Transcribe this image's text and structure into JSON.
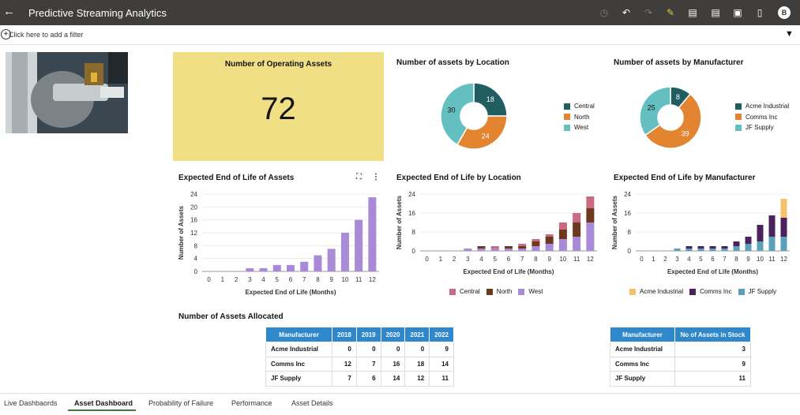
{
  "header": {
    "back_icon": "back-arrow-icon",
    "title": "Predictive Streaming Analytics",
    "avatar": "B"
  },
  "filterbar": {
    "placeholder": "Click here to add a filter"
  },
  "kpi": {
    "title": "Number of Operating Assets",
    "value": "72",
    "bg": "#f0df85"
  },
  "colors": {
    "central": "#c96b82",
    "north": "#6e3a1f",
    "west": "#a98ad6",
    "teal": "#215e62",
    "orange": "#e28430",
    "lightteal": "#64bfc0",
    "acme": "#f5c26b",
    "comms": "#4b225e",
    "jf": "#5aa1b8",
    "bar": "#a98ad6",
    "table_header": "#2f87cc"
  },
  "charts": {
    "location_pie": {
      "title": "Number of assets by Location",
      "legend": [
        "Central",
        "North",
        "West"
      ],
      "chart_data": {
        "type": "pie",
        "categories": [
          "Central",
          "North",
          "West"
        ],
        "values": [
          18,
          24,
          30
        ]
      }
    },
    "manufacturer_pie": {
      "title": "Number of assets by Manufacturer",
      "legend": [
        "Acme Industrial",
        "Comms Inc",
        "JF Supply"
      ],
      "chart_data": {
        "type": "pie",
        "categories": [
          "Acme Industrial",
          "Comms Inc",
          "JF Supply"
        ],
        "values": [
          8,
          39,
          25
        ]
      }
    },
    "eol_assets": {
      "title": "Expected End of Life of Assets",
      "chart_data": {
        "type": "bar",
        "categories": [
          "0",
          "1",
          "2",
          "3",
          "4",
          "5",
          "6",
          "7",
          "8",
          "9",
          "10",
          "11",
          "12"
        ],
        "values": [
          0,
          0,
          0,
          1,
          1,
          2,
          2,
          3,
          5,
          7,
          12,
          16,
          23
        ],
        "xlabel": "Expected End of Life (Months)",
        "ylabel": "Number of Assets",
        "ylim": [
          0,
          24
        ],
        "yticks": [
          0,
          4,
          8,
          12,
          16,
          20,
          24
        ]
      }
    },
    "eol_location": {
      "title": "Expected End of Life by Location",
      "legend": [
        "Central",
        "North",
        "West"
      ],
      "chart_data": {
        "type": "bar",
        "stacked": true,
        "categories": [
          "0",
          "1",
          "2",
          "3",
          "4",
          "5",
          "6",
          "7",
          "8",
          "9",
          "10",
          "11",
          "12"
        ],
        "series": [
          {
            "name": "West",
            "values": [
              0,
              0,
              0,
              1,
              1,
              1,
              1,
              1,
              2,
              3,
              5,
              6,
              12
            ]
          },
          {
            "name": "North",
            "values": [
              0,
              0,
              0,
              0,
              1,
              0,
              1,
              1,
              2,
              3,
              4,
              6,
              6
            ]
          },
          {
            "name": "Central",
            "values": [
              0,
              0,
              0,
              0,
              0,
              1,
              0,
              1,
              1,
              1,
              3,
              4,
              5
            ]
          }
        ],
        "xlabel": "Expected End of Life (Months)",
        "ylabel": "Number of Assets",
        "ylim": [
          0,
          24
        ],
        "yticks": [
          0,
          8,
          16,
          24
        ]
      }
    },
    "eol_manufacturer": {
      "title": "Expected End of Life by Manufacturer",
      "legend": [
        "Acme Industrial",
        "Comms Inc",
        "JF Supply"
      ],
      "chart_data": {
        "type": "bar",
        "stacked": true,
        "categories": [
          "0",
          "1",
          "2",
          "3",
          "4",
          "5",
          "6",
          "7",
          "8",
          "9",
          "10",
          "11",
          "12"
        ],
        "series": [
          {
            "name": "JF Supply",
            "values": [
              0,
              0,
              0,
              1,
              1,
              1,
              1,
              1,
              2,
              3,
              4,
              6,
              6
            ]
          },
          {
            "name": "Comms Inc",
            "values": [
              0,
              0,
              0,
              0,
              1,
              1,
              1,
              1,
              2,
              3,
              7,
              9,
              8
            ]
          },
          {
            "name": "Acme Industrial",
            "values": [
              0,
              0,
              0,
              0,
              0,
              0,
              0,
              0,
              0,
              0,
              0,
              0,
              8
            ]
          }
        ],
        "xlabel": "Expected End of Life (Months)",
        "ylabel": "Number of Assets",
        "ylim": [
          0,
          24
        ],
        "yticks": [
          0,
          8,
          16,
          24
        ]
      }
    }
  },
  "allocated": {
    "title": "Number of Assets Allocated",
    "headers": [
      "Manufacturer",
      "2018",
      "2019",
      "2020",
      "2021",
      "2022"
    ],
    "rows": [
      [
        "Acme Industrial",
        "0",
        "0",
        "0",
        "0",
        "9"
      ],
      [
        "Comms Inc",
        "12",
        "7",
        "16",
        "18",
        "14"
      ],
      [
        "JF Supply",
        "7",
        "6",
        "14",
        "12",
        "11"
      ]
    ]
  },
  "stock": {
    "headers": [
      "Manufacturer",
      "No of Assets in Stock"
    ],
    "rows": [
      [
        "Acme Industrial",
        "3"
      ],
      [
        "Comms Inc",
        "9"
      ],
      [
        "JF Supply",
        "11"
      ]
    ]
  },
  "tabs": [
    "Live Dashbaords",
    "Asset Dashboard",
    "Probability of Failure",
    "Performance",
    "Asset Details"
  ]
}
